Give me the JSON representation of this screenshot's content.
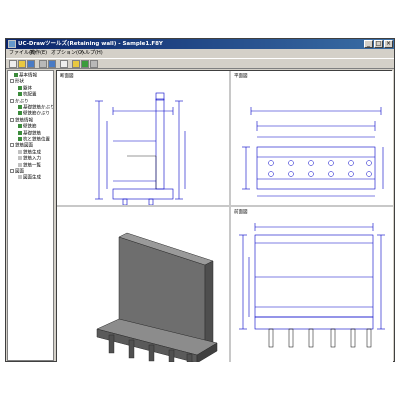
{
  "window": {
    "title": "UC-Drawツールズ(Retaining wall) - Sample1.F8Y",
    "min_glyph": "_",
    "max_glyph": "□",
    "close_glyph": "×"
  },
  "menu": {
    "items": [
      "ファイル(F)",
      "操作(E)",
      "オプション(O)",
      "ヘルプ(H)"
    ]
  },
  "toolbar": {
    "buttons": [
      "new-icon",
      "open-icon",
      "save-icon",
      "print-icon",
      "preview-icon",
      "copy-icon",
      "help-icon",
      "info-icon",
      "settings-icon"
    ]
  },
  "tree": {
    "items": [
      {
        "label": "基本情報",
        "indent": 1,
        "icon": "green"
      },
      {
        "label": "形状",
        "indent": 0,
        "icon": "minus"
      },
      {
        "label": "躯体",
        "indent": 2,
        "icon": "green"
      },
      {
        "label": "杭配置",
        "indent": 2,
        "icon": "green"
      },
      {
        "label": "かぶり",
        "indent": 0,
        "icon": "minus"
      },
      {
        "label": "基礎鉄筋かぶり",
        "indent": 2,
        "icon": "green"
      },
      {
        "label": "壁鉄筋かぶり",
        "indent": 2,
        "icon": "green"
      },
      {
        "label": "鉄筋情報",
        "indent": 0,
        "icon": "minus"
      },
      {
        "label": "壁鉄筋",
        "indent": 2,
        "icon": "green"
      },
      {
        "label": "基礎鉄筋",
        "indent": 2,
        "icon": "green"
      },
      {
        "label": "杭と鉄筋位置",
        "indent": 2,
        "icon": "green"
      },
      {
        "label": "鉄筋図面",
        "indent": 0,
        "icon": "minus"
      },
      {
        "label": "鉄筋生成",
        "indent": 2,
        "icon": "plain"
      },
      {
        "label": "鉄筋入力",
        "indent": 2,
        "icon": "plain"
      },
      {
        "label": "鉄筋一覧",
        "indent": 2,
        "icon": "plain"
      },
      {
        "label": "図面",
        "indent": 0,
        "icon": "minus"
      },
      {
        "label": "図面生成",
        "indent": 2,
        "icon": "plain"
      }
    ]
  },
  "views": {
    "side_label": "断面図",
    "plan_label": "平面図",
    "front_label": "前面図"
  },
  "colors": {
    "drawing_line": "#0000c8",
    "title_start": "#0a246a",
    "title_end": "#3a6ea5"
  }
}
